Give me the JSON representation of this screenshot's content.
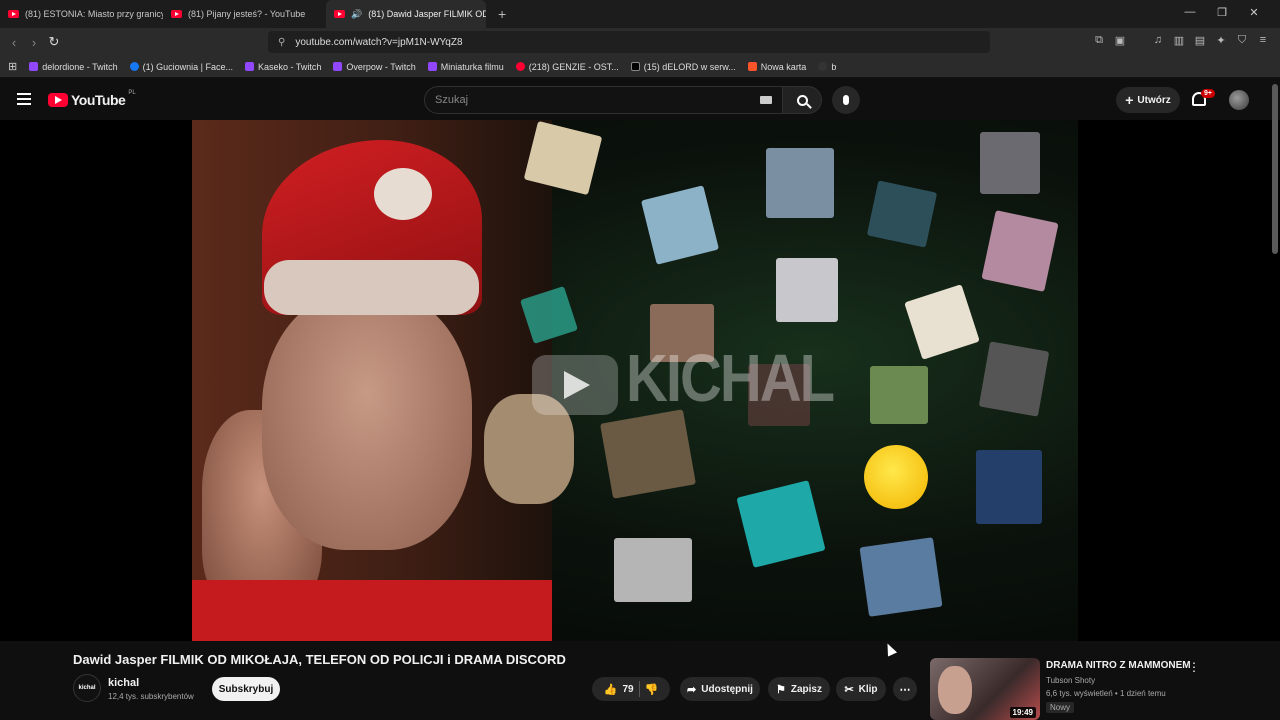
{
  "browser": {
    "tabs": [
      {
        "label": "(81) ESTONIA: Miasto przy granicy z"
      },
      {
        "label": "(81) Pijany jesteś? - YouTube"
      },
      {
        "label": "(81) Dawid Jasper FILMIK OD"
      }
    ],
    "url": "youtube.com/watch?v=jpM1N-WYqZ8",
    "bookmarks": [
      {
        "label": "delordione - Twitch"
      },
      {
        "label": "(1) Guciownia | Face..."
      },
      {
        "label": "Kaseko - Twitch"
      },
      {
        "label": "Overpow - Twitch"
      },
      {
        "label": "Miniaturka filmu"
      },
      {
        "label": "(218) GENZIE - OST..."
      },
      {
        "label": "(15) dELORD w serw..."
      },
      {
        "label": "Nowa karta"
      },
      {
        "label": "b"
      }
    ]
  },
  "masthead": {
    "logo_text": "YouTube",
    "logo_country": "PL",
    "search_placeholder": "Szukaj",
    "create_label": "Utwórz",
    "notif_count": "9+"
  },
  "player": {
    "watermark": "KICHAL"
  },
  "video": {
    "title": "Dawid Jasper FILMIK OD MIKOŁAJA, TELEFON OD POLICJI i DRAMA DISCORD",
    "channel_avatar_text": "kichal",
    "channel_name": "kichal",
    "subscribers": "12,4 tys. subskrybentów",
    "subscribe_label": "Subskrybuj",
    "likes": "79",
    "share_label": "Udostępnij",
    "save_label": "Zapisz",
    "clip_label": "Klip"
  },
  "recommendation": {
    "title": "DRAMA NITRO Z MAMMONEM",
    "channel": "Tubson Shoty",
    "meta": "6,6 tys. wyświetleń • 1 dzień temu",
    "badge": "Nowy",
    "duration": "19:49"
  },
  "colors": {
    "youtube_red": "#ff0033",
    "background": "#0f0f0f",
    "pill": "#272727"
  }
}
